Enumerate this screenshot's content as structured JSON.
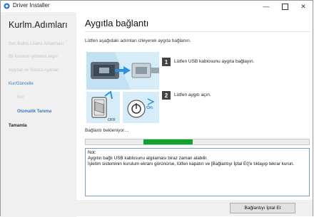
{
  "window": {
    "title": "Driver Installer"
  },
  "sidebar": {
    "title": "Kurlm.Adımları",
    "items": [
      {
        "label": "Son Kullnc.Lisans Anlaşması",
        "state": "inactive"
      },
      {
        "label": "Bir kurulum yöntemi seçin",
        "state": "inactive"
      },
      {
        "label": "Aygıtlar ve Sürücü Ayarları",
        "state": "inactive"
      },
      {
        "label": "Kur/Güncelle",
        "state": "active"
      },
      {
        "label": "Kur",
        "state": "inactive"
      },
      {
        "label": "Otomatik Tanıma",
        "state": "current"
      },
      {
        "label": "Tamamla",
        "state": "done"
      }
    ]
  },
  "main": {
    "title": "Aygıtla bağlantı",
    "instruction": "Lütfen aşağıdaki adımları izleyerek aygıta bağlanın.",
    "steps": [
      {
        "number": "1",
        "text": "Lütfen USB kablosunu aygıta bağlayın."
      },
      {
        "number": "2",
        "text": "Lütfen aygıtı açın."
      }
    ],
    "illustration": {
      "off_label": "OFF",
      "on_label": "On"
    },
    "status": "Bağlantı bekleniyor…",
    "progress": {
      "fill_start": 0.26,
      "fill_width": 0.22,
      "color": "#0fa32d"
    },
    "note": {
      "heading": "Not:",
      "line1": "Aygıtın bağlı USB kablosunu algılaması biraz zaman alabilir.",
      "line2": "İşletim sisteminin kurulum ekranı görünürse, lütfen kapatın ve [Bağlantıyı İptal Et]'e tıklayıp tekrar kurun."
    }
  },
  "footer": {
    "cancel_label": "Bağlantıyı İptal Et"
  }
}
